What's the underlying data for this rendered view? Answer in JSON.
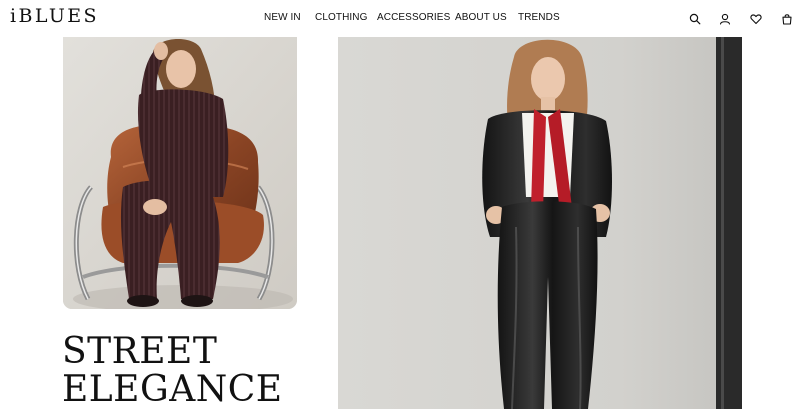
{
  "brand": {
    "logo_text": "iBLUES"
  },
  "nav": {
    "items": [
      {
        "label": "NEW IN"
      },
      {
        "label": "CLOTHING"
      },
      {
        "label": "ACCESSORIES"
      },
      {
        "label": "ABOUT US"
      },
      {
        "label": "TRENDS"
      }
    ]
  },
  "header_icons": [
    "search-icon",
    "user-icon",
    "heart-icon",
    "bag-icon"
  ],
  "hero": {
    "headline_line1": "STREET",
    "headline_line2": "ELEGANCE"
  },
  "colors": {
    "background": "#ffffff",
    "text": "#111111",
    "scarf_red": "#c0202c",
    "leather_black": "#1a1a1a",
    "backdrop_grey": "#d6d5d1"
  }
}
